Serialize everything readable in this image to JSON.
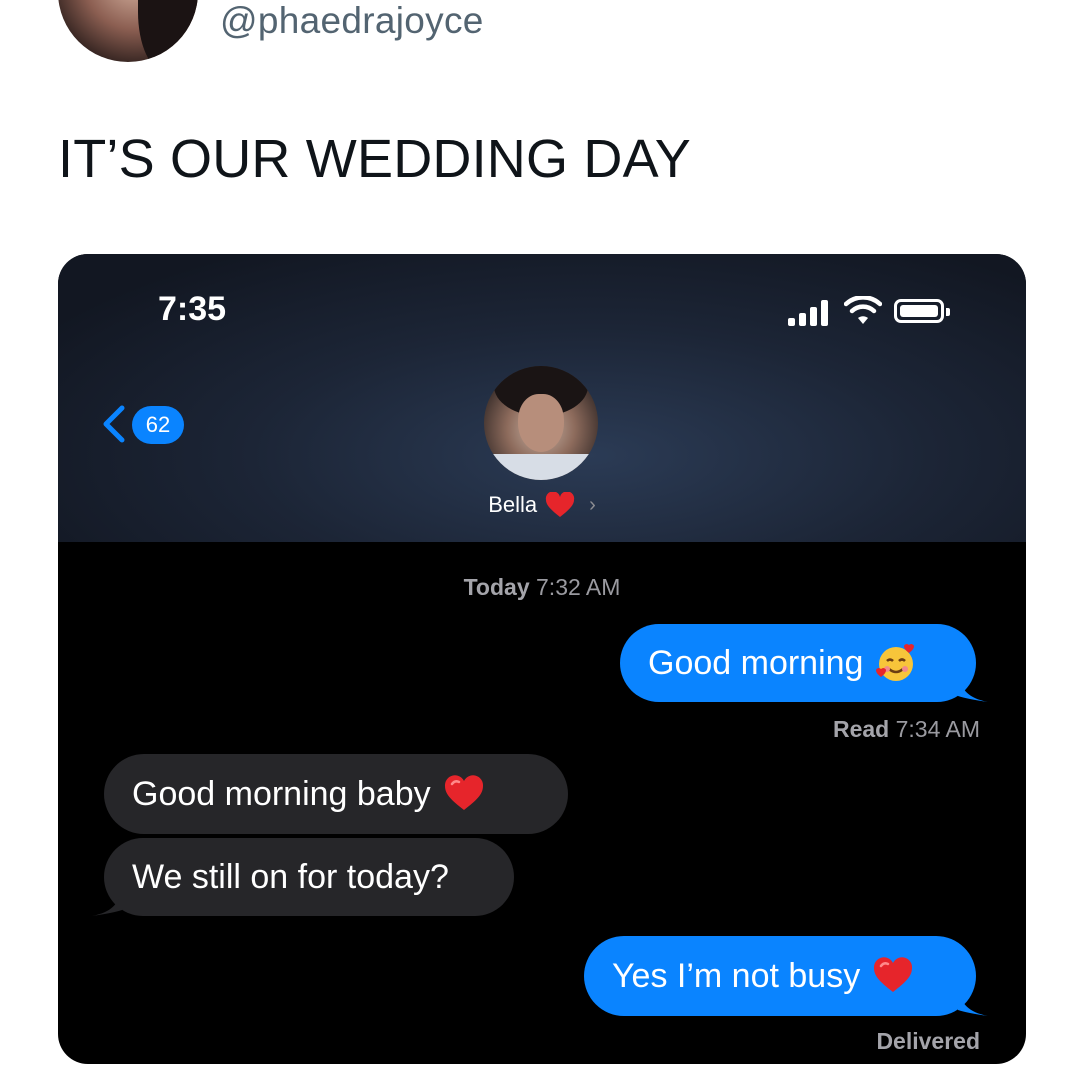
{
  "tweet": {
    "handle": "@phaedrajoyce",
    "text": "IT’S OUR WEDDING DAY"
  },
  "phone": {
    "status_time": "7:35",
    "back_badge": "62",
    "contact_name": "Bella",
    "contact_emoji": "red-heart",
    "timestamp_day": "Today",
    "timestamp_time": "7:32 AM",
    "messages": [
      {
        "direction": "sent",
        "text": "Good morning",
        "emoji": "smiling-face-with-hearts"
      },
      {
        "direction": "received",
        "text": "Good morning baby",
        "emoji": "red-heart"
      },
      {
        "direction": "received",
        "text": "We still on for today?"
      },
      {
        "direction": "sent",
        "text": "Yes I’m not busy",
        "emoji": "red-heart"
      }
    ],
    "read_receipt": {
      "label": "Read",
      "time": "7:34 AM"
    },
    "delivered_receipt": "Delivered",
    "colors": {
      "sent_bubble": "#0a84ff",
      "received_bubble": "#262629",
      "background": "#000000"
    }
  }
}
